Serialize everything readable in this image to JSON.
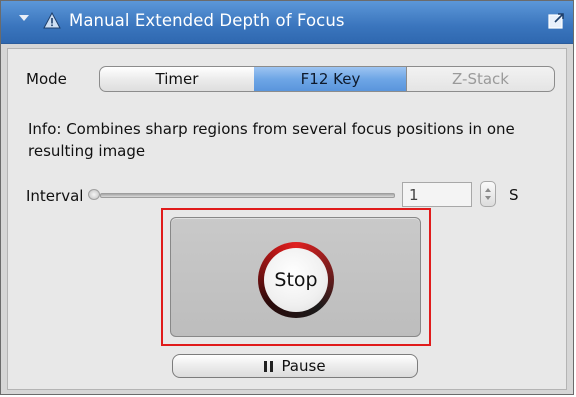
{
  "window": {
    "title": "Manual Extended Depth of Focus",
    "colors": {
      "titlebar": "#3a75bd",
      "accent_selected": "#6ea6e6",
      "highlight_border": "#e01b1b"
    }
  },
  "mode": {
    "label": "Mode",
    "options": [
      "Timer",
      "F12 Key",
      "Z-Stack"
    ],
    "selected": "F12 Key"
  },
  "info": {
    "text": "Info: Combines sharp regions from several focus positions in one resulting image"
  },
  "interval": {
    "label": "Interval",
    "value": "1",
    "unit": "S"
  },
  "actions": {
    "stop_label": "Stop",
    "pause_label": "Pause"
  },
  "icons": {
    "collapse": "collapse-triangle-icon",
    "alert": "warning-triangle-icon",
    "float": "undock-window-icon",
    "pause": "pause-icon"
  }
}
